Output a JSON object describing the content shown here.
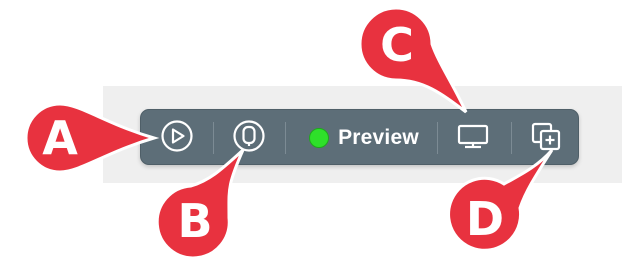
{
  "toolbar": {
    "preview_label": "Preview",
    "buttons": [
      {
        "icon": "play-circle-icon"
      },
      {
        "icon": "device-icon"
      },
      {
        "icon": "display-icon"
      },
      {
        "icon": "duplicate-add-icon"
      }
    ],
    "colors": {
      "background": "#5d6e78",
      "preview_indicator": "#2ee02a",
      "icon_stroke": "#ffffff"
    }
  },
  "callouts": {
    "a": "A",
    "b": "B",
    "c": "C",
    "d": "D",
    "color": "#e8323f"
  }
}
